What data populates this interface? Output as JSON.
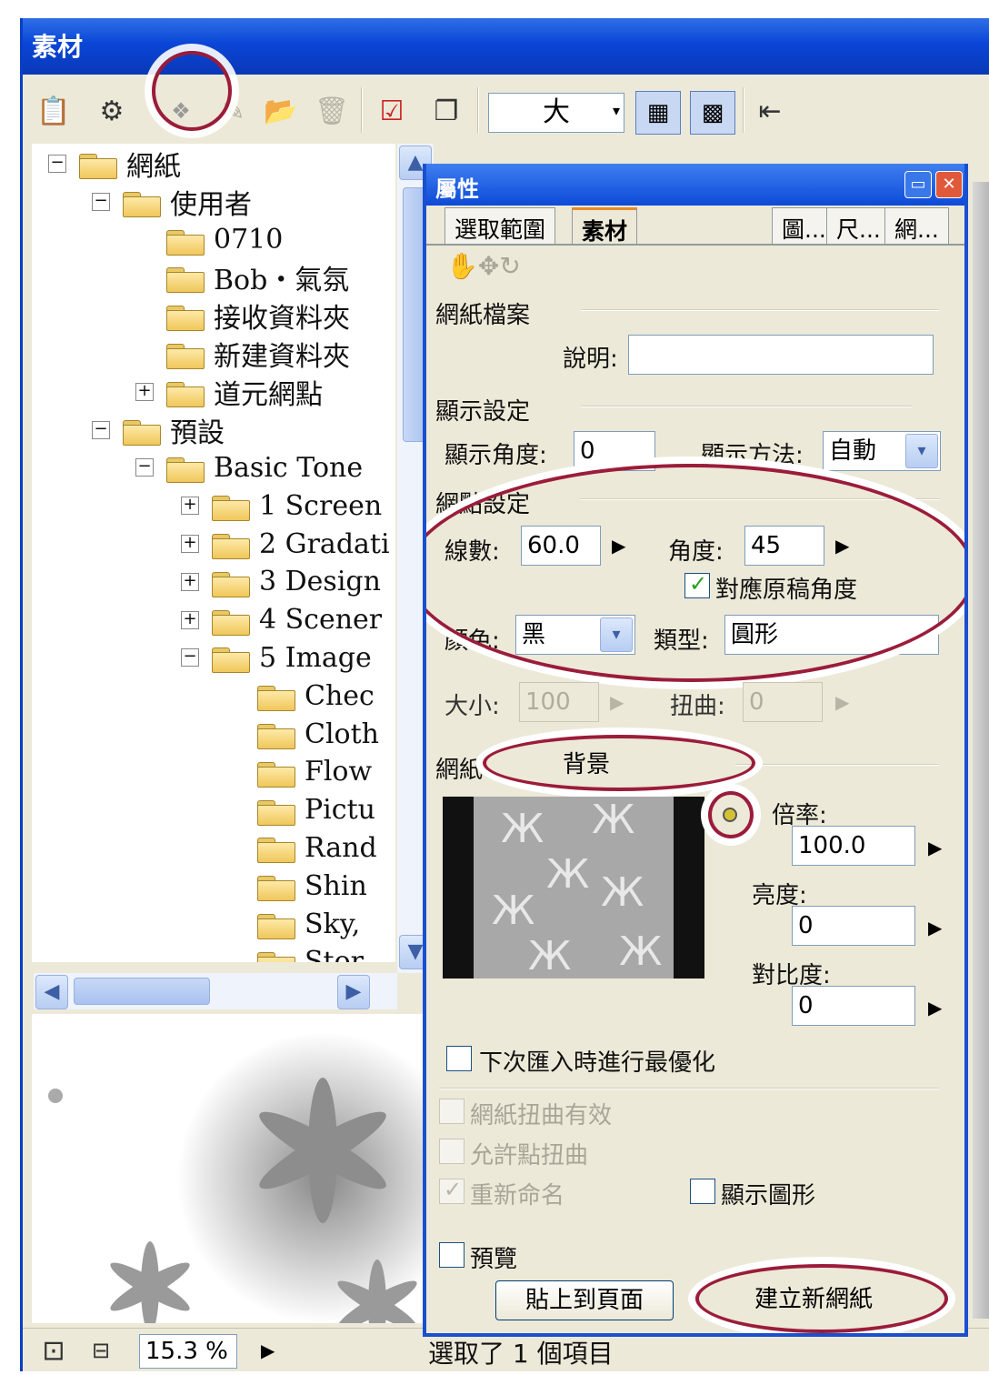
{
  "window": {
    "title": "素材"
  },
  "toolbar": {
    "size_value": "大"
  },
  "tree": [
    {
      "label": "網紙",
      "expander": "−",
      "depth": 0
    },
    {
      "label": "使用者",
      "expander": "−",
      "depth": 1
    },
    {
      "label": "0710",
      "expander": "",
      "depth": 2
    },
    {
      "label": "Bob・氣氛",
      "expander": "",
      "depth": 2
    },
    {
      "label": "接收資料夾",
      "expander": "",
      "depth": 2
    },
    {
      "label": "新建資料夾",
      "expander": "",
      "depth": 2
    },
    {
      "label": "道元網點",
      "expander": "+",
      "depth": 2
    },
    {
      "label": "預設",
      "expander": "−",
      "depth": 1
    },
    {
      "label": "Basic Tone",
      "expander": "−",
      "depth": 2
    },
    {
      "label": "1 Screen",
      "expander": "+",
      "depth": 3
    },
    {
      "label": "2 Gradati",
      "expander": "+",
      "depth": 3
    },
    {
      "label": "3 Design",
      "expander": "+",
      "depth": 3
    },
    {
      "label": "4 Scener",
      "expander": "+",
      "depth": 3
    },
    {
      "label": "5 Image",
      "expander": "−",
      "depth": 3
    },
    {
      "label": "Chec",
      "expander": "",
      "depth": 4
    },
    {
      "label": "Cloth",
      "expander": "",
      "depth": 4
    },
    {
      "label": "Flow",
      "expander": "",
      "depth": 4
    },
    {
      "label": "Pictu",
      "expander": "",
      "depth": 4
    },
    {
      "label": "Rand",
      "expander": "",
      "depth": 4
    },
    {
      "label": "Shin",
      "expander": "",
      "depth": 4
    },
    {
      "label": "Sky,",
      "expander": "",
      "depth": 4
    },
    {
      "label": "Stor",
      "expander": "",
      "depth": 4
    }
  ],
  "status": {
    "zoom": "15.3 %",
    "message": "選取了 1 個項目"
  },
  "props": {
    "title": "屬性",
    "tabs": [
      "選取範圍",
      "素材",
      "圖...",
      "尺...",
      "網..."
    ],
    "sec_file": "網紙檔案",
    "desc_label": "說明:",
    "desc_value": "",
    "sec_display": "顯示設定",
    "angle_label": "顯示角度:",
    "angle_value": "0",
    "method_label": "顯示方法:",
    "method_value": "自動",
    "sec_tone": "網點設定",
    "lines_label": "線數:",
    "lines_value": "60.0",
    "deg_label": "角度:",
    "deg_value": "45",
    "follow_label": "對應原稿角度",
    "color_label": "顏色:",
    "color_value": "黑",
    "type_label": "類型:",
    "type_value": "圓形",
    "size_label": "大小:",
    "size_value": "100",
    "warp_label": "扭曲:",
    "warp_value": "0",
    "bg_label": "網紙",
    "bg_value": "背景",
    "rate_label": "倍率:",
    "rate_value": "100.0",
    "bright_label": "亮度:",
    "bright_value": "0",
    "contrast_label": "對比度:",
    "contrast_value": "0",
    "opt_label": "下次匯入時進行最優化",
    "distort_label": "網紙扭曲有效",
    "allow_label": "允許點扭曲",
    "rename_label": "重新命名",
    "showshape_label": "顯示圖形",
    "preview_label": "預覽",
    "paste_btn": "貼上到頁面",
    "create_btn": "建立新網紙"
  },
  "colors": {
    "titlebar": "#0a46d6",
    "highlight_ring": "#9b1c3a",
    "panel": "#ece9d8"
  }
}
